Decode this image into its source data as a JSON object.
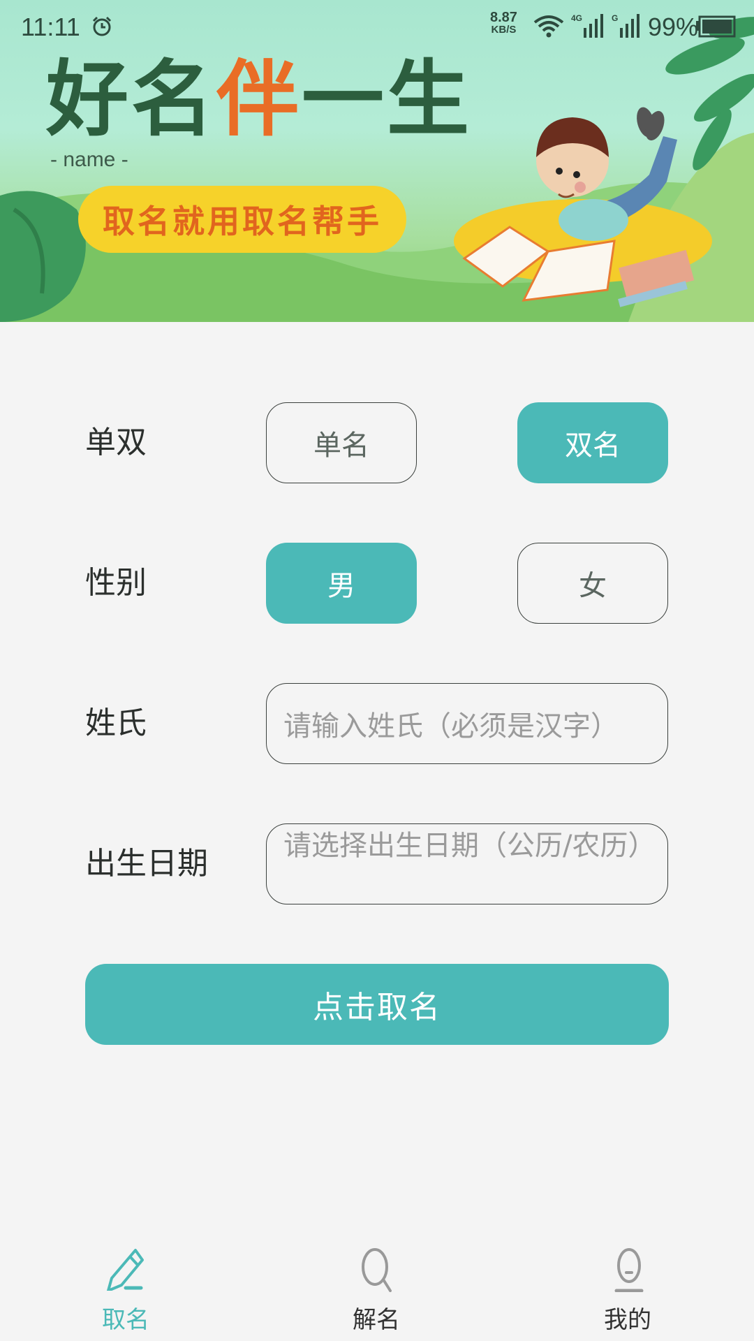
{
  "status_bar": {
    "time": "11:11",
    "net_speed_value": "8.87",
    "net_speed_unit": "KB/S",
    "sim1_label": "4G",
    "sim2_label": "G",
    "battery_percent": "99%",
    "icons": [
      "alarm-icon",
      "wifi-icon",
      "signal-icon",
      "signal-icon",
      "battery-icon"
    ]
  },
  "banner": {
    "title_part1": "好名",
    "title_highlight": "伴",
    "title_part2": "一生",
    "subtitle": "- name -",
    "slogan": "取名就用取名帮手",
    "colors": {
      "title": "#2c5e3e",
      "highlight": "#e96d26",
      "slogan_bg": "#f6d22a",
      "slogan_text": "#e1651e"
    }
  },
  "form": {
    "name_type": {
      "label": "单双",
      "options": [
        {
          "label": "单名",
          "selected": false
        },
        {
          "label": "双名",
          "selected": true
        }
      ]
    },
    "gender": {
      "label": "性别",
      "options": [
        {
          "label": "男",
          "selected": true
        },
        {
          "label": "女",
          "selected": false
        }
      ]
    },
    "surname": {
      "label": "姓氏",
      "value": "",
      "placeholder": "请输入姓氏（必须是汉字）"
    },
    "birthdate": {
      "label": "出生日期",
      "value": "",
      "placeholder": "请选择出生日期（公历/农历）"
    },
    "submit_label": "点击取名"
  },
  "tabbar": {
    "tabs": [
      {
        "label": "取名",
        "icon": "pencil-icon",
        "active": true
      },
      {
        "label": "解名",
        "icon": "search-icon",
        "active": false
      },
      {
        "label": "我的",
        "icon": "profile-icon",
        "active": false
      }
    ]
  },
  "theme": {
    "accent": "#4bb9b7",
    "background": "#f4f4f4",
    "text": "#2b2f2d",
    "placeholder": "#9a9a9a"
  }
}
